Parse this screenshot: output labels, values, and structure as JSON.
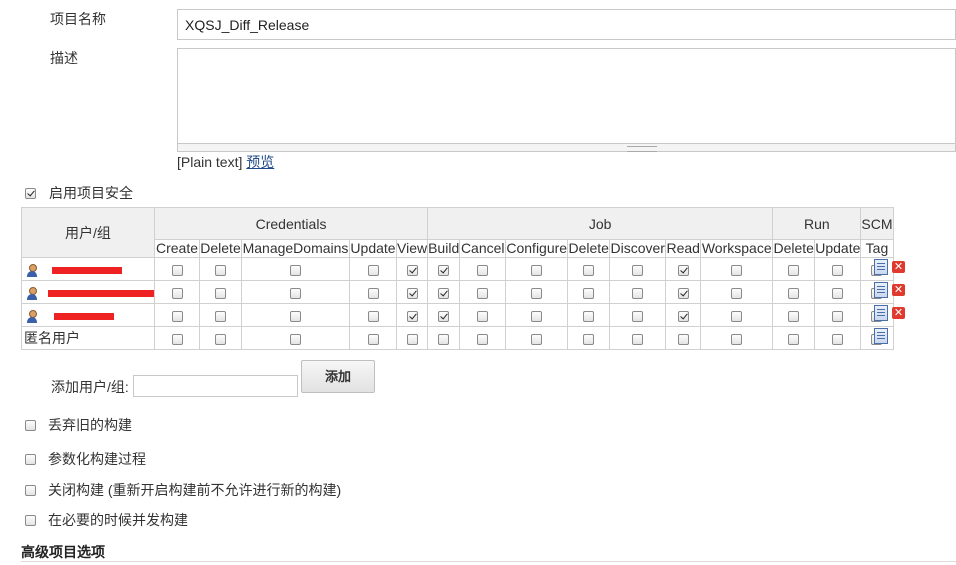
{
  "project": {
    "name_label": "项目名称",
    "name_value": "XQSJ_Diff_Release",
    "desc_label": "描述",
    "desc_value": "",
    "plain_text": "[Plain text]",
    "preview_link": "预览"
  },
  "security": {
    "enable_label": "启用项目安全",
    "enabled": true,
    "user_group_header": "用户/组",
    "groups": [
      {
        "name": "Credentials",
        "columns": [
          "Create",
          "Delete",
          "ManageDomains",
          "Update",
          "View"
        ]
      },
      {
        "name": "Job",
        "columns": [
          "Build",
          "Cancel",
          "Configure",
          "Delete",
          "Discover",
          "Read",
          "Workspace"
        ]
      },
      {
        "name": "Run",
        "columns": [
          "Delete",
          "Update"
        ]
      },
      {
        "name": "SCM",
        "columns": [
          "Tag"
        ]
      }
    ],
    "rows": [
      {
        "name": "",
        "redacted": true,
        "icon": "user-icon",
        "checked": [
          false,
          false,
          false,
          false,
          true,
          true,
          false,
          false,
          false,
          false,
          true,
          false,
          false,
          false,
          false
        ],
        "removable": true
      },
      {
        "name": "",
        "redacted": true,
        "icon": "user-icon",
        "checked": [
          false,
          false,
          false,
          false,
          true,
          true,
          false,
          false,
          false,
          false,
          true,
          false,
          false,
          false,
          false
        ],
        "removable": true
      },
      {
        "name": "",
        "redacted": true,
        "icon": "user-icon",
        "checked": [
          false,
          false,
          false,
          false,
          true,
          true,
          false,
          false,
          false,
          false,
          true,
          false,
          false,
          false,
          false
        ],
        "removable": true
      },
      {
        "name": "匿名用户",
        "redacted": false,
        "icon": "",
        "checked": [
          false,
          false,
          false,
          false,
          false,
          false,
          false,
          false,
          false,
          false,
          false,
          false,
          false,
          false,
          false
        ],
        "removable": false
      }
    ],
    "add_label": "添加用户/组:",
    "add_value": "",
    "add_button": "添加"
  },
  "options": [
    {
      "label": "丢弃旧的构建",
      "checked": false
    },
    {
      "label": "参数化构建过程",
      "checked": false
    },
    {
      "label": "关闭构建 (重新开启构建前不允许进行新的构建)",
      "checked": false
    },
    {
      "label": "在必要的时候并发构建",
      "checked": false
    }
  ],
  "advanced": {
    "title": "高级项目选项"
  },
  "icons": {
    "edit": "edit-permissions-icon",
    "remove": "remove-icon",
    "user": "user-icon"
  },
  "colors": {
    "redaction": "#ee2222",
    "header_bg": "#f0f0f0",
    "link": "#204a87",
    "remove": "#e03a2e"
  }
}
